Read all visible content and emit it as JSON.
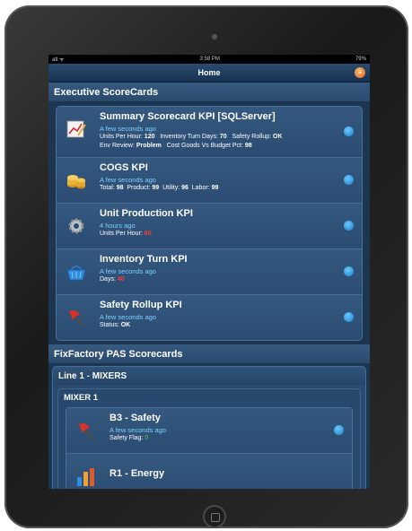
{
  "status_bar": {
    "left": "atl  ᯤ",
    "time": "3:58 PM",
    "right": "79%"
  },
  "nav": {
    "title": "Home",
    "menu_icon": "menu-icon"
  },
  "section1": {
    "title": "Executive ScoreCards"
  },
  "kpis": [
    {
      "title": "Summary Scorecard  KPI [SQLServer]",
      "time": "A few seconds ago",
      "l1a": "Units Per Hour: ",
      "l1a_v": "120",
      "l1b": "   Inventory Turn Days: ",
      "l1b_v": "70",
      "l1c": "   Safety Rollup: ",
      "l1c_v": "OK",
      "l2a": "Env Review: ",
      "l2a_v": "Problem",
      "l2b": "   Cost Goods Vs Budget Pct: ",
      "l2b_v": "98",
      "icon": "chart-pencil-icon"
    },
    {
      "title": "COGS KPI",
      "time": "A few seconds ago",
      "t1": "Total: ",
      "v1": "98",
      "t2": "  Product: ",
      "v2": "99",
      "t3": "  Utility: ",
      "v3": "96",
      "t4": "  Labor: ",
      "v4": "99",
      "icon": "coins-icon"
    },
    {
      "title": "Unit Production KPI",
      "time": "4 hours ago",
      "label": "Units Per Hour: ",
      "value": "60",
      "icon": "gear-icon"
    },
    {
      "title": "Inventory Turn KPI",
      "time": "A few seconds ago",
      "label": "Days: ",
      "value": "40",
      "icon": "basket-icon"
    },
    {
      "title": "Safety Rollup KPI",
      "time": "A few seconds ago",
      "label": "Status: ",
      "value": "OK",
      "icon": "flag-icon"
    }
  ],
  "section2": {
    "title": "FixFactory  PAS  Scorecards"
  },
  "line": {
    "title": "Line 1 - MIXERS"
  },
  "mixer": {
    "title": "MIXER 1"
  },
  "mixer_items": [
    {
      "title": "B3 - Safety",
      "time": "A few seconds ago",
      "label": "Safety Flag: ",
      "value": "0",
      "icon": "flag-icon"
    },
    {
      "title": "R1 - Energy",
      "icon": "bar-chart-icon"
    }
  ],
  "colors": {
    "accent": "#7fd0ff",
    "alert": "#ff3b3b",
    "ok": "#58d04a",
    "background": "#1c3550"
  }
}
